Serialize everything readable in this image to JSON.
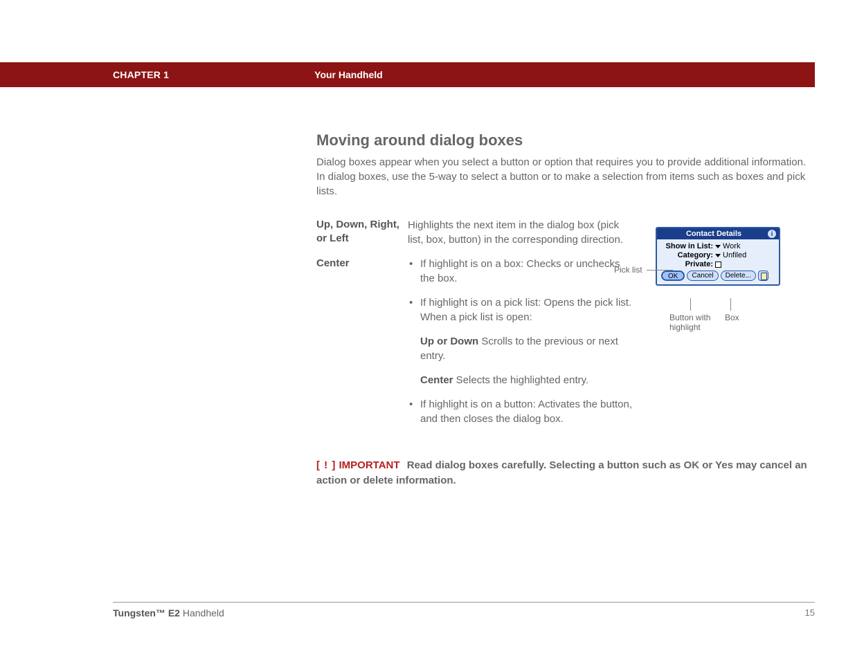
{
  "header": {
    "chapter": "CHAPTER 1",
    "section": "Your Handheld"
  },
  "title": "Moving around dialog boxes",
  "lead": "Dialog boxes appear when you select a button or option that requires you to provide additional information. In dialog boxes, use the 5-way to select a button or to make a selection from items such as boxes and pick lists.",
  "rows": {
    "r1": {
      "key": "Up, Down, Right, or Left",
      "val": "Highlights the next item in the dialog box (pick list, box, button) in the corresponding direction."
    },
    "r2": {
      "key": "Center",
      "b1": "If highlight is on a box: Checks or unchecks the box.",
      "b2_intro": "If highlight is on a pick list: Opens the pick list. When a pick list is open:",
      "b2_sub1_key": "Up or Down",
      "b2_sub1_val": " Scrolls to the previous or next entry.",
      "b2_sub2_key": "Center",
      "b2_sub2_val": " Selects the highlighted entry.",
      "b3": "If highlight is on a button: Activates the button, and then closes the dialog box."
    }
  },
  "important": {
    "bracket": "[ ! ]",
    "label": "IMPORTANT",
    "text": "Read dialog boxes carefully. Selecting a button such as OK or Yes may cancel an action or delete information."
  },
  "figure": {
    "picklist_label": "Pick list",
    "dialog_title": "Contact Details",
    "show_label": "Show in List:",
    "show_val": "Work",
    "cat_label": "Category:",
    "cat_val": "Unfiled",
    "priv_label": "Private:",
    "ok": "OK",
    "cancel": "Cancel",
    "delete": "Delete...",
    "callout_btn_l1": "Button with",
    "callout_btn_l2": "highlight",
    "callout_box": "Box"
  },
  "footer": {
    "product_bold": "Tungsten™ E2",
    "product_rest": " Handheld",
    "page": "15"
  }
}
